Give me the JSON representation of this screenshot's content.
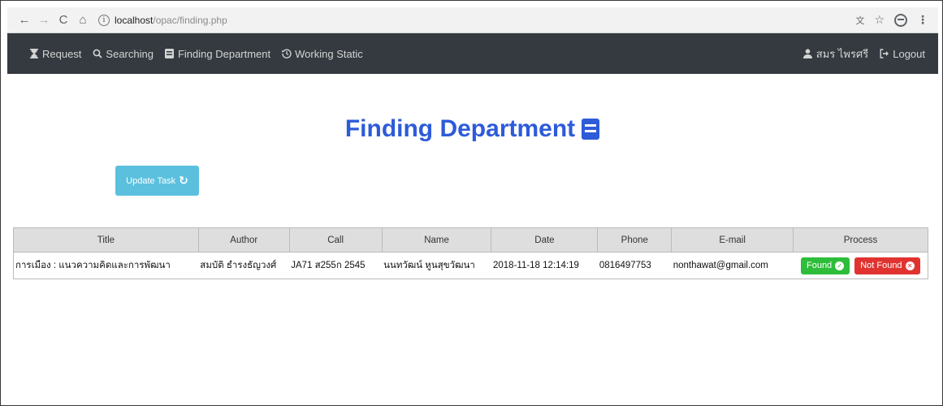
{
  "browser": {
    "url_host": "localhost",
    "url_path": "/opac/finding.php"
  },
  "nav": {
    "left": [
      {
        "label": "Request",
        "icon": "hourglass-icon"
      },
      {
        "label": "Searching",
        "icon": "search-icon"
      },
      {
        "label": "Finding Department",
        "icon": "book-icon"
      },
      {
        "label": "Working Static",
        "icon": "history-icon"
      }
    ],
    "user": {
      "label": "สมร ไพรศรี",
      "icon": "user-icon"
    },
    "logout": {
      "label": "Logout",
      "icon": "logout-icon"
    }
  },
  "page": {
    "title": "Finding Department"
  },
  "update_button": {
    "label": "Update Task"
  },
  "table": {
    "headers": [
      "Title",
      "Author",
      "Call",
      "Name",
      "Date",
      "Phone",
      "E-mail",
      "Process"
    ],
    "rows": [
      {
        "title": "การเมือง : แนวความคิดและการพัฒนา",
        "author": "สมบัติ ธำรงธัญวงศ์",
        "call": "JA71 ส255ก 2545",
        "name": "นนทวัฒน์ หูนสุขวัฒนา",
        "date": "2018-11-18 12:14:19",
        "phone": "0816497753",
        "email": "nonthawat@gmail.com",
        "found_label": "Found",
        "not_found_label": "Not Found"
      }
    ]
  },
  "colors": {
    "navbar": "#343a40",
    "title": "#2d5bd9",
    "update_button": "#5bc0de",
    "found": "#2ebd3a",
    "not_found": "#e0332f"
  }
}
